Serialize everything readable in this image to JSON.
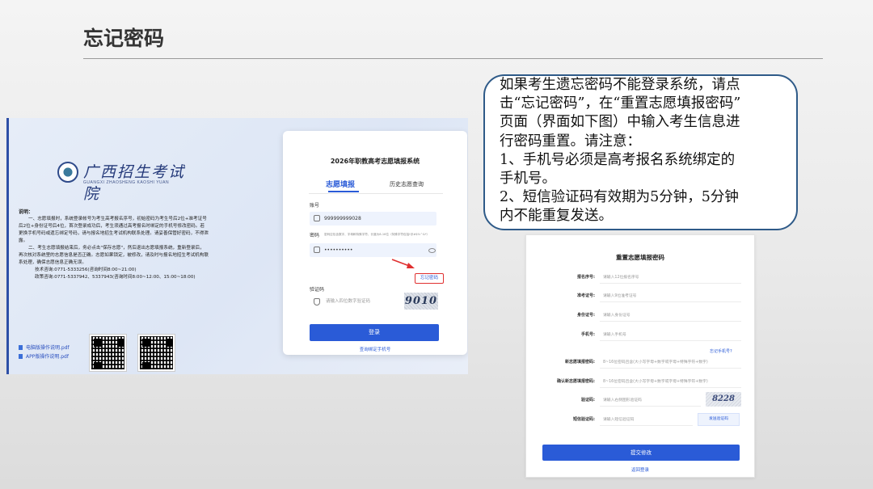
{
  "slide": {
    "title": "忘记密码"
  },
  "left_screenshot": {
    "logo_text": "广西招生考试院",
    "logo_sub": "GUANGXI ZHAOSHENG KAOSHI YUAN",
    "notice_heading": "说明：",
    "notice_p1": "一、志愿填报时，系统登录帐号为考生高考报名序号，初始密码为考生号后2位+准考证号后2位+身份证号后4位，首次登录成功后，考生须通过高考报名时绑定的手机号修改密码。若更换手机号码或遗忘绑定号码，请与报名地招生考试机构联系处理。请妥善保管好密码，不得泄露。",
    "notice_p2": "二、考生志愿填报结束后，务必点击\"保存志愿\"，然后退出志愿填报系统，重新登录后，再次核对系统里的志愿信息是否正确。志愿如果锁定，被修改，请及时与报名地招生考试机构联系处理，确保志愿信息正确无误。",
    "contact_1": "技术咨询:0771-5333256(咨询时间8:00~21:00)",
    "contact_2": "政策咨询:0771-5337942、5337943(咨询时间8:00~12:00、15:00~18:00)",
    "link_pc_manual": "电脑版操作说明.pdf",
    "link_app_manual": "APP版操作说明.pdf",
    "login": {
      "system_title": "2026年职教高考志愿填报系统",
      "tab_active": "志愿填报",
      "tab_inactive": "历史志愿查询",
      "account_label": "账号",
      "account_value": "999999999028",
      "password_label": "密码",
      "password_hint": "密码应包含数字、字母和特殊字符，长度为8-16位（特殊字符包括!@#$%^&*）",
      "password_value": "••••••••••",
      "forgot_link": "忘记密码",
      "captcha_label": "验证码",
      "captcha_placeholder": "请输入四位数字验证码",
      "captcha_code": "9010",
      "login_button": "登录",
      "bind_phone_link": "查询绑定手机号"
    }
  },
  "callout": {
    "lines": [
      "如果考生遗忘密码不能登录系统，请点",
      "击“忘记密码”，在“重置志愿填报密码”",
      "页面（界面如下图）中输入考生信息进",
      "行密码重置。请注意：",
      "1、手机号必须是高考报名系统绑定的",
      "手机号。",
      "2、短信验证码有效期为5分钟，5分钟",
      "内不能重复发送。"
    ]
  },
  "reset_form": {
    "title": "重置志愿填报密码",
    "fields": [
      {
        "label": "报名序号:",
        "placeholder": "请输入12位报名序号"
      },
      {
        "label": "准考证号:",
        "placeholder": "请输入9位准考证号"
      },
      {
        "label": "身份证号:",
        "placeholder": "请输入身份证号"
      },
      {
        "label": "手机号:",
        "placeholder": "请输入手机号"
      },
      {
        "label": "新志愿填报密码:",
        "placeholder": "8~16位密码且含(大小写字母+数字或字母+特殊字符+数字)"
      },
      {
        "label": "确认新志愿填报密码:",
        "placeholder": "8~16位密码且含(大小写字母+数字或字母+特殊字符+数字)"
      },
      {
        "label": "验证码:",
        "placeholder": "请输入右侧图形验证码"
      },
      {
        "label": "短信验证码:",
        "placeholder": "请输入短信验证码"
      }
    ],
    "forgot_phone_link": "忘记手机号?",
    "captcha_code": "8228",
    "send_sms_button": "发送验证码",
    "submit_button": "提交修改",
    "back_link": "返回登录"
  },
  "colors": {
    "accent": "#2a5bd7",
    "callout_border": "#2e5a88",
    "highlight_red": "#e03030"
  }
}
